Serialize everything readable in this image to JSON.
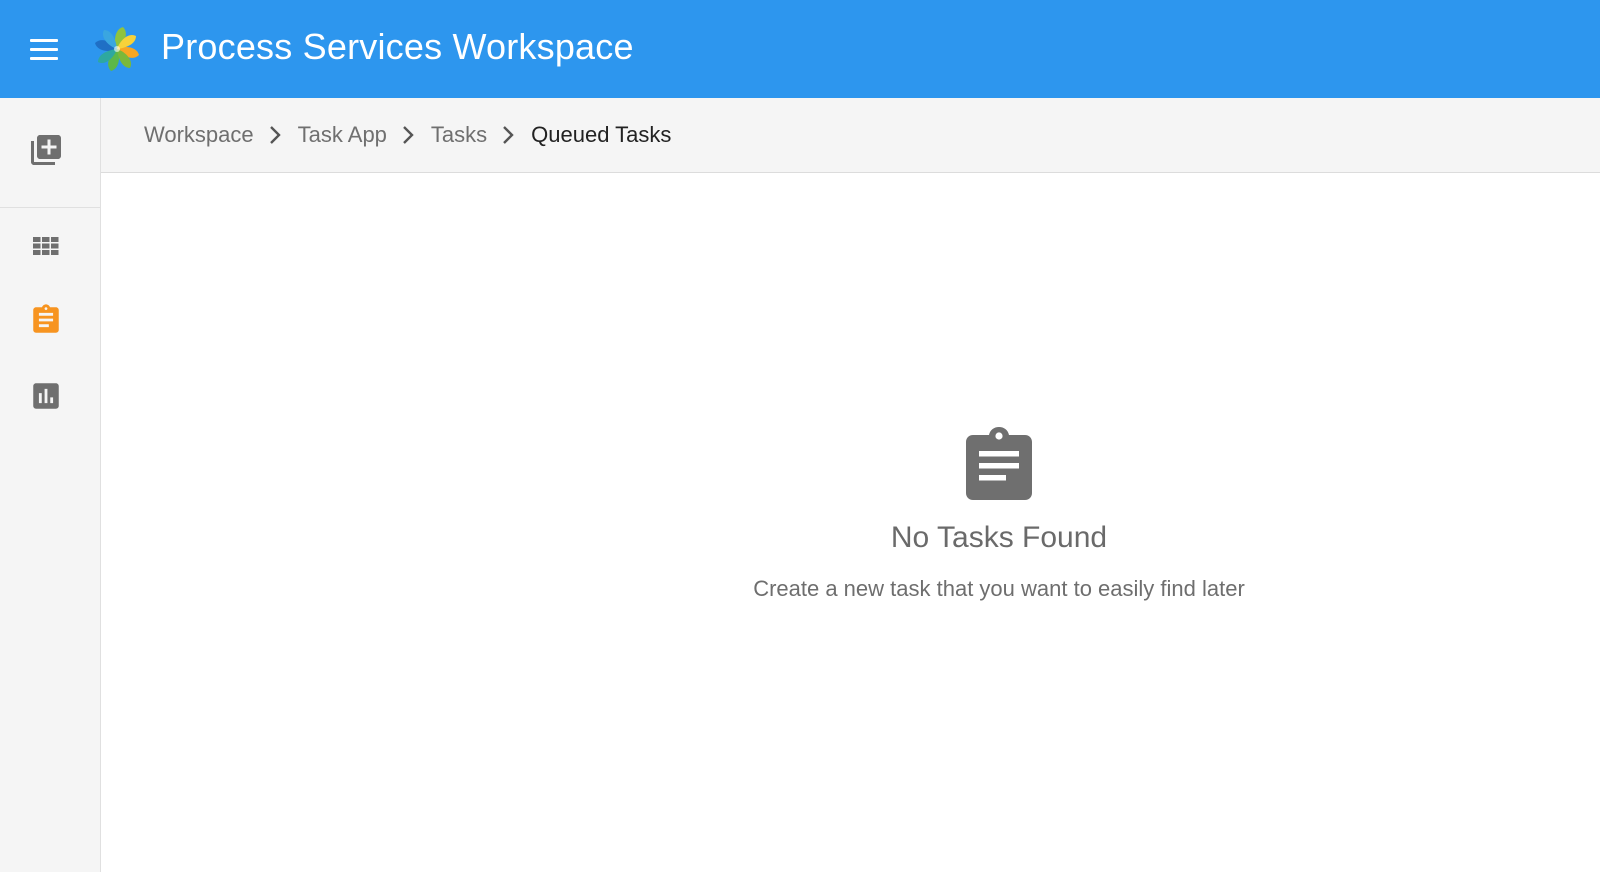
{
  "header": {
    "title": "Process Services Workspace",
    "menu_icon": "hamburger-menu-icon",
    "logo": "alfresco-flower-logo",
    "background": "#2d96ee"
  },
  "sidebar": {
    "items": [
      {
        "name": "create-icon",
        "label": ""
      },
      {
        "name": "apps-grid-icon",
        "label": ""
      },
      {
        "name": "tasks-clipboard-icon",
        "label": "",
        "active": true,
        "color": "#f79420"
      },
      {
        "name": "reports-chart-icon",
        "label": ""
      }
    ]
  },
  "breadcrumb": {
    "items": [
      "Workspace",
      "Task App",
      "Tasks"
    ],
    "current": "Queued Tasks",
    "separator_icon": "chevron-right-icon"
  },
  "empty_state": {
    "icon": "assignment-clipboard-icon",
    "title": "No Tasks Found",
    "subtitle": "Create a new task that you want to easily find later"
  },
  "colors": {
    "accent": "#2d96ee",
    "active": "#f79420",
    "icon_gray": "#6f6f6f"
  }
}
